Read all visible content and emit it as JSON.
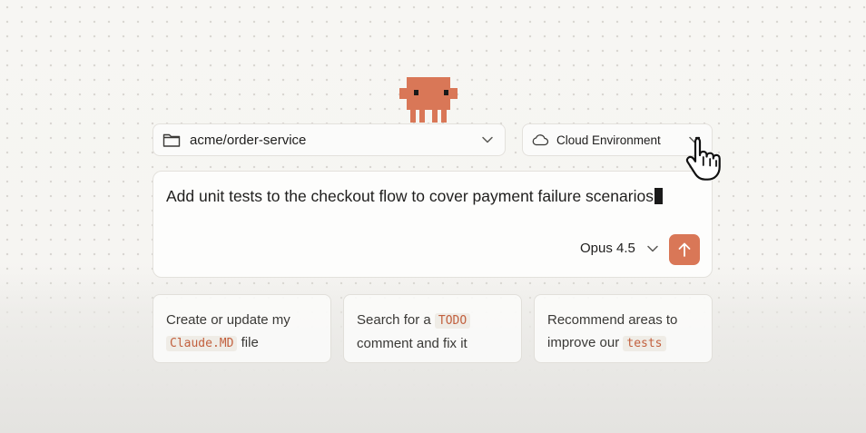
{
  "repo_select": {
    "value": "acme/order-service",
    "icon": "folder-icon"
  },
  "env_select": {
    "value": "Cloud Environment",
    "icon": "cloud-icon"
  },
  "composer": {
    "text": "Add unit tests to the checkout flow to cover payment failure scenarios",
    "model": "Opus 4.5"
  },
  "suggestions": [
    {
      "before": "Create or update my",
      "code": "Claude.MD",
      "after": "file"
    },
    {
      "before": "Search for a",
      "code": "TODO",
      "after": "comment and fix it"
    },
    {
      "before": "Recommend areas to",
      "mid": "improve our",
      "code": "tests"
    }
  ],
  "colors": {
    "accent": "#d97757",
    "code_text": "#c2603e",
    "background": "#f6f5f2"
  }
}
